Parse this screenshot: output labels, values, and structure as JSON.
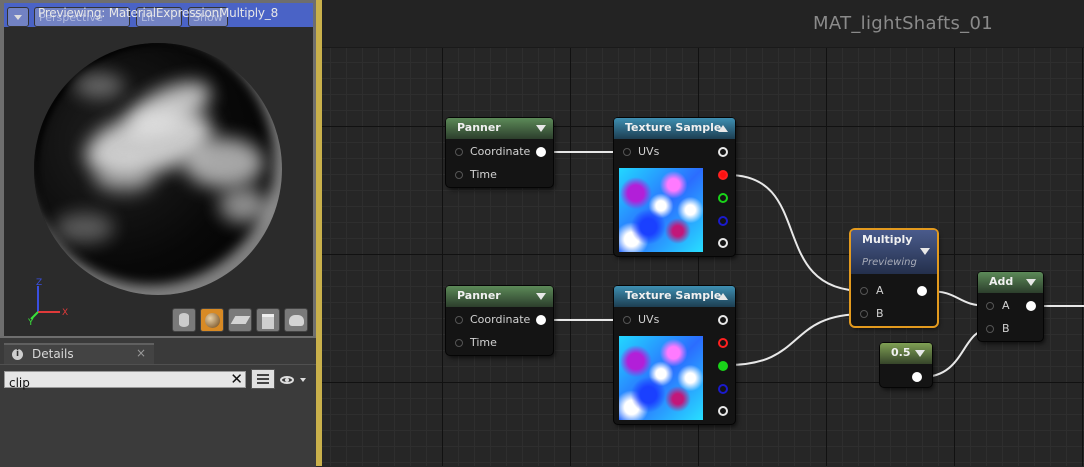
{
  "viewport": {
    "title": "Previewing: MaterialExpressionMultiply_8",
    "dropdown_icon": "chevron-down-icon",
    "view_mode_button": "Perspective",
    "lit_button": "Lit",
    "show_button": "Show",
    "axis_labels": {
      "x": "X",
      "y": "Y",
      "z": "Z"
    },
    "preview_shapes": [
      "cylinder",
      "sphere",
      "plane",
      "cube",
      "custom-mesh"
    ]
  },
  "details": {
    "tab_label": "Details",
    "tab_close": "×",
    "search_value": "clip",
    "search_clear": "✕",
    "grid_icon": "list-view-icon",
    "eye_icon": "eye-icon"
  },
  "graph": {
    "material_name": "MAT_lightShafts_01",
    "nodes": {
      "panner1": {
        "title": "Panner",
        "pins": [
          "Coordinate",
          "Time"
        ]
      },
      "texsample1": {
        "title": "Texture Sample",
        "pins": [
          "UVs"
        ]
      },
      "panner2": {
        "title": "Panner",
        "pins": [
          "Coordinate",
          "Time"
        ]
      },
      "texsample2": {
        "title": "Texture Sample",
        "pins": [
          "UVs"
        ]
      },
      "multiply": {
        "title": "Multiply",
        "subtitle": "Previewing",
        "pins": [
          "A",
          "B"
        ]
      },
      "add": {
        "title": "Add",
        "pins": [
          "A",
          "B"
        ]
      },
      "constant": {
        "title": "0.5"
      }
    }
  },
  "colors": {
    "viewport_title_bar": "#4a63c6",
    "selected_node_outline": "#e39a1e",
    "graph_left_border": "#c9b04b",
    "pin_red": "#ff1010",
    "pin_green": "#19d319",
    "pin_blue": "#1a1acc"
  }
}
